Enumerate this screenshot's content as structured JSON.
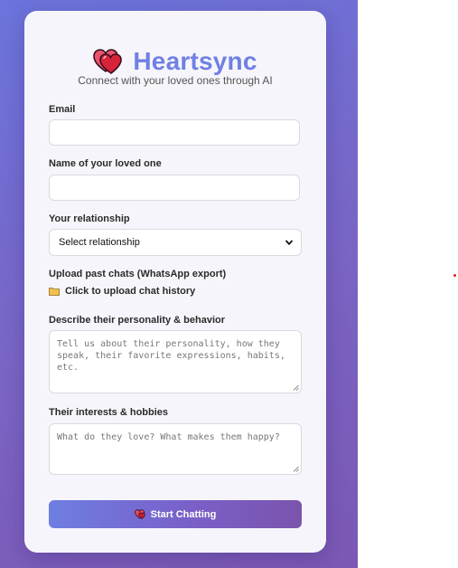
{
  "brand": {
    "title": "Heartsync",
    "tagline": "Connect with your loved ones through AI",
    "icon": "two-hearts-icon"
  },
  "form": {
    "email_label": "Email",
    "email_value": "",
    "name_label": "Name of your loved one",
    "name_value": "",
    "relationship_label": "Your relationship",
    "relationship_selected": "Select relationship",
    "upload_label": "Upload past chats (WhatsApp export)",
    "upload_link": "Click to upload chat history",
    "personality_label": "Describe their personality & behavior",
    "personality_placeholder": "Tell us about their personality, how they speak, their favorite expressions, habits, etc.",
    "interests_label": "Their interests & hobbies",
    "interests_placeholder": "What do they love? What makes them happy?",
    "submit_label": "Start Chatting"
  },
  "colors": {
    "brand": "#6f80e4",
    "gradient_start": "#6e7ee2",
    "gradient_end": "#7b54ad",
    "heart": "#d8243a"
  }
}
